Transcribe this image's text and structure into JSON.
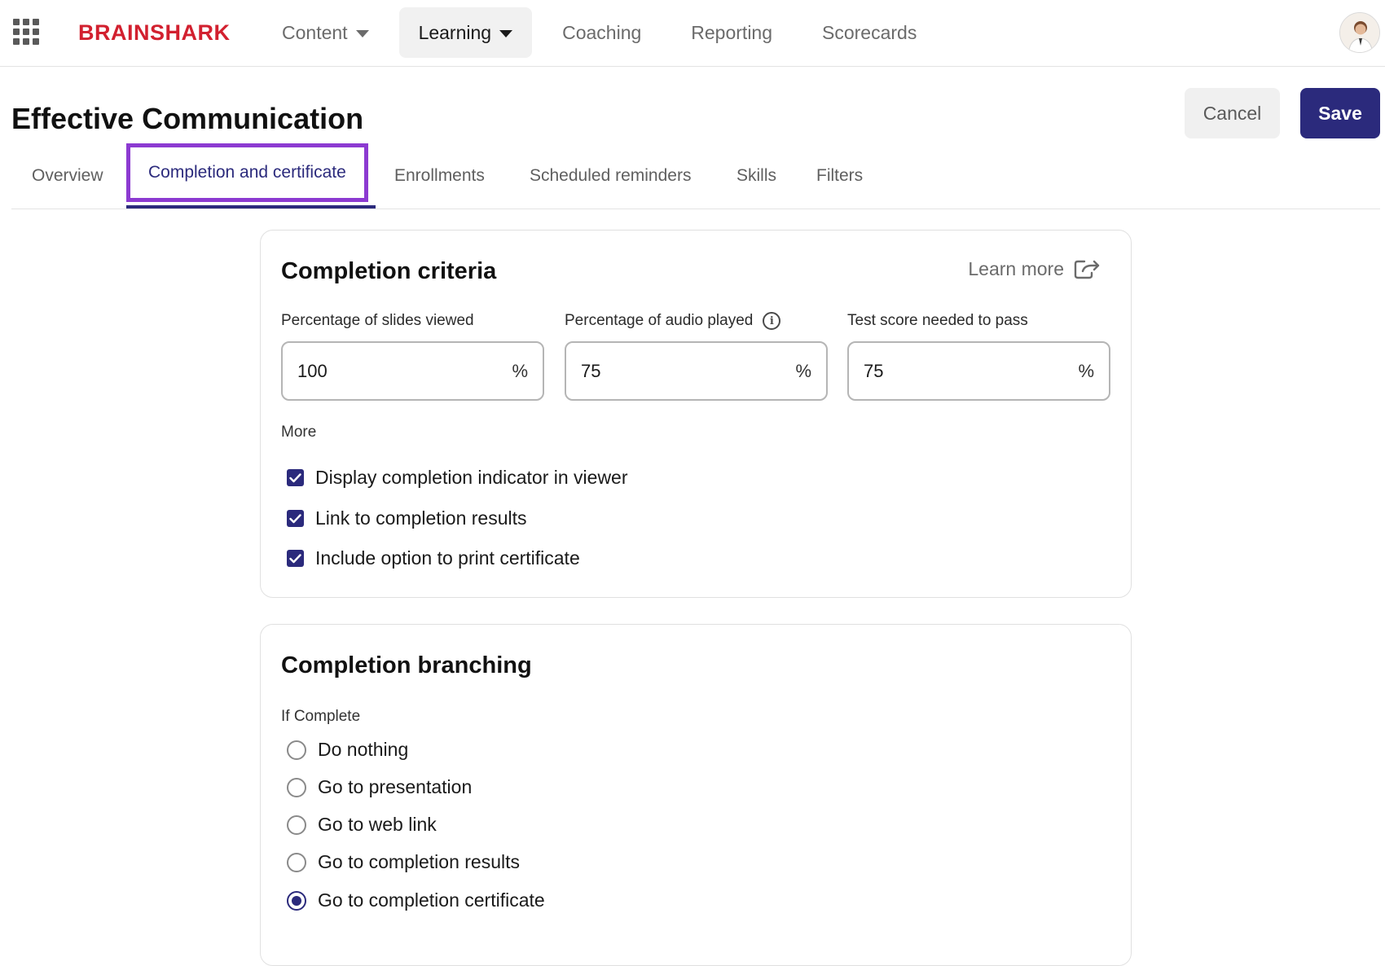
{
  "brand": "BRAINSHARK",
  "nav": {
    "items": [
      {
        "label": "Content",
        "dropdown": true,
        "active": false
      },
      {
        "label": "Learning",
        "dropdown": true,
        "active": true
      },
      {
        "label": "Coaching",
        "dropdown": false,
        "active": false
      },
      {
        "label": "Reporting",
        "dropdown": false,
        "active": false
      },
      {
        "label": "Scorecards",
        "dropdown": false,
        "active": false
      }
    ]
  },
  "header": {
    "title": "Effective Communication",
    "cancel_label": "Cancel",
    "save_label": "Save"
  },
  "tabs": [
    {
      "label": "Overview",
      "selected": false
    },
    {
      "label": "Completion and certificate",
      "selected": true
    },
    {
      "label": "Enrollments",
      "selected": false
    },
    {
      "label": "Scheduled reminders",
      "selected": false
    },
    {
      "label": "Skills",
      "selected": false
    },
    {
      "label": "Filters",
      "selected": false
    }
  ],
  "criteria": {
    "title": "Completion criteria",
    "learn_more": "Learn more",
    "fields": [
      {
        "label": "Percentage of slides viewed",
        "value": "100",
        "unit": "%"
      },
      {
        "label": "Percentage of audio played",
        "value": "75",
        "unit": "%"
      },
      {
        "label": "Test score needed to pass",
        "value": "75",
        "unit": "%"
      }
    ],
    "more_label": "More",
    "options": [
      {
        "label": "Display completion indicator in viewer",
        "checked": true
      },
      {
        "label": "Link to completion results",
        "checked": true
      },
      {
        "label": "Include option to print certificate",
        "checked": true
      }
    ]
  },
  "branching": {
    "title": "Completion branching",
    "if_label": "If Complete",
    "options": [
      {
        "label": "Do nothing",
        "selected": false
      },
      {
        "label": "Go to presentation",
        "selected": false
      },
      {
        "label": "Go to web link",
        "selected": false
      },
      {
        "label": "Go to completion results",
        "selected": false
      },
      {
        "label": "Go to completion certificate",
        "selected": true
      }
    ]
  },
  "colors": {
    "brand_red": "#d2202f",
    "primary": "#2b2a7c",
    "highlight": "#8c3ad1"
  }
}
